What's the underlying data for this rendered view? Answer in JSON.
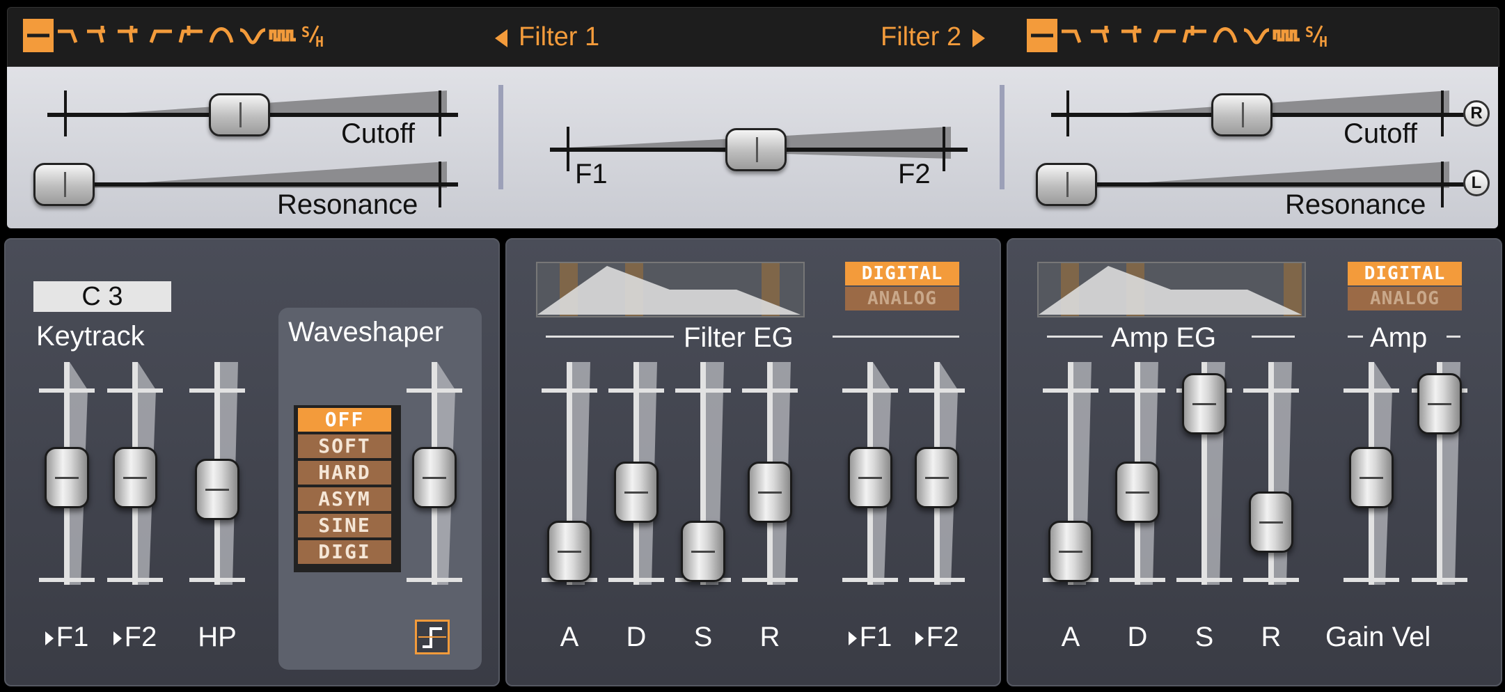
{
  "colors": {
    "accent": "#f39b3b",
    "accent_dim": "#9b6a46",
    "panel": "#43464f",
    "strip": "#d7d9df"
  },
  "filter_types": [
    "bypass-icon",
    "lowpass-12-icon",
    "lowpass-24-icon",
    "lowpass-48-icon",
    "highpass-12-icon",
    "highpass-24-icon",
    "bandpass-icon",
    "notch-icon",
    "comb-icon",
    "sample-hold-icon"
  ],
  "header": {
    "filter1_label": "Filter 1",
    "filter2_label": "Filter 2",
    "filter1_selected": "bypass",
    "filter2_selected": "bypass"
  },
  "filter1": {
    "cutoff_label": "Cutoff",
    "resonance_label": "Resonance",
    "cutoff_value": 0.46,
    "resonance_value": 0.0
  },
  "morph": {
    "f1_label": "F1",
    "f2_label": "F2",
    "value": 0.5
  },
  "filter2": {
    "cutoff_label": "Cutoff",
    "resonance_label": "Resonance",
    "cutoff_value": 0.46,
    "resonance_value": 0.0,
    "r_button": "R",
    "l_button": "L"
  },
  "keytrack": {
    "note": "C 3",
    "label": "Keytrack",
    "sliders": [
      {
        "label": "F1",
        "value": 0.5
      },
      {
        "label": "F2",
        "value": 0.5
      },
      {
        "label": "HP",
        "value": 0.42
      }
    ]
  },
  "waveshaper": {
    "label": "Waveshaper",
    "options": [
      "OFF",
      "SOFT",
      "HARD",
      "ASYM",
      "SINE",
      "DIGI"
    ],
    "selected": "OFF",
    "value": 0.5
  },
  "filter_eg": {
    "label": "Filter EG",
    "mode_digital": "DIGITAL",
    "mode_analog": "ANALOG",
    "mode": "DIGITAL",
    "sliders": [
      {
        "label": "A",
        "value": 0.0
      },
      {
        "label": "D",
        "value": 0.4
      },
      {
        "label": "S",
        "value": 0.0
      },
      {
        "label": "R",
        "value": 0.4
      }
    ],
    "mod": [
      {
        "label": "F1",
        "value": 0.5
      },
      {
        "label": "F2",
        "value": 0.5
      }
    ]
  },
  "amp_eg": {
    "label": "Amp EG",
    "mode_digital": "DIGITAL",
    "mode_analog": "ANALOG",
    "mode": "DIGITAL",
    "sliders": [
      {
        "label": "A",
        "value": 0.0
      },
      {
        "label": "D",
        "value": 0.4
      },
      {
        "label": "S",
        "value": 1.0
      },
      {
        "label": "R",
        "value": 0.2
      }
    ]
  },
  "amp": {
    "label": "Amp",
    "sliders": [
      {
        "label": "Gain",
        "value": 0.5
      },
      {
        "label": "Vel",
        "value": 1.0
      }
    ],
    "gain_vel_label": "Gain Vel"
  }
}
